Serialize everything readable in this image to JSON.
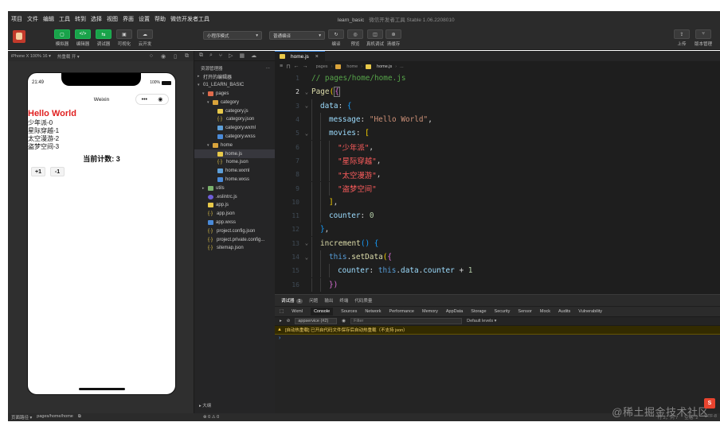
{
  "menubar": {
    "items": [
      "项目",
      "文件",
      "编辑",
      "工具",
      "转到",
      "选择",
      "视图",
      "界面",
      "设置",
      "帮助",
      "微信开发者工具"
    ],
    "project_name": "learn_basic",
    "app_title": "微信开发者工具 Stable 1.06.2208010"
  },
  "toolbar": {
    "buttons": [
      {
        "label": "模拟器",
        "icon": "phone-icon"
      },
      {
        "label": "编辑器",
        "icon": "code-icon"
      },
      {
        "label": "调试器",
        "icon": "debug-icon"
      },
      {
        "label": "可视化",
        "icon": "visual-icon"
      },
      {
        "label": "云开发",
        "icon": "cloud-icon"
      }
    ],
    "mode_select": "小程序模式",
    "compile_select": "普通编译",
    "right_buttons": [
      {
        "label": "编译",
        "icon": "refresh-icon"
      },
      {
        "label": "预览",
        "icon": "eye-icon"
      },
      {
        "label": "真机调试",
        "icon": "realdevice-icon"
      },
      {
        "label": "清缓存",
        "icon": "clear-cache-icon"
      }
    ],
    "far_right_buttons": [
      {
        "label": "上传",
        "icon": "upload-icon"
      },
      {
        "label": "版本管理",
        "icon": "version-icon"
      }
    ]
  },
  "simulator": {
    "device": "iPhone X 100% 16 ▾",
    "hot_reload": "热重载 开 ▾",
    "time": "21:49",
    "battery": "100%",
    "nav_title": "Weixin",
    "hello": "Hello World",
    "movies": [
      "少年派-0",
      "星际穿越-1",
      "太空漫游-2",
      "盗梦空间-3"
    ],
    "counter_text": "当前计数: 3",
    "btn_plus": "+1",
    "btn_minus": "-1"
  },
  "explorer": {
    "header": "资源管理器",
    "open_editors": "打开的编辑器",
    "project": "01_LEARN_BASIC",
    "outline": "大纲"
  },
  "tree": [
    {
      "label": "pages",
      "depth": 1,
      "type": "folder-pages",
      "arrow": "▾"
    },
    {
      "label": "category",
      "depth": 2,
      "type": "folder",
      "arrow": "▾"
    },
    {
      "label": "category.js",
      "depth": 3,
      "type": "js",
      "arrow": ""
    },
    {
      "label": "category.json",
      "depth": 3,
      "type": "json",
      "arrow": ""
    },
    {
      "label": "category.wxml",
      "depth": 3,
      "type": "wxml",
      "arrow": ""
    },
    {
      "label": "category.wxss",
      "depth": 3,
      "type": "wxss",
      "arrow": ""
    },
    {
      "label": "home",
      "depth": 2,
      "type": "folder",
      "arrow": "▾"
    },
    {
      "label": "home.js",
      "depth": 3,
      "type": "js",
      "arrow": "",
      "active": true
    },
    {
      "label": "home.json",
      "depth": 3,
      "type": "json",
      "arrow": ""
    },
    {
      "label": "home.wxml",
      "depth": 3,
      "type": "wxml",
      "arrow": ""
    },
    {
      "label": "home.wxss",
      "depth": 3,
      "type": "wxss",
      "arrow": ""
    },
    {
      "label": "utils",
      "depth": 1,
      "type": "folder-utils",
      "arrow": "▸"
    },
    {
      "label": ".eslintrc.js",
      "depth": 1,
      "type": "eslint",
      "arrow": ""
    },
    {
      "label": "app.js",
      "depth": 1,
      "type": "js",
      "arrow": ""
    },
    {
      "label": "app.json",
      "depth": 1,
      "type": "json",
      "arrow": ""
    },
    {
      "label": "app.wxss",
      "depth": 1,
      "type": "wxss",
      "arrow": ""
    },
    {
      "label": "project.config.json",
      "depth": 1,
      "type": "json",
      "arrow": ""
    },
    {
      "label": "project.private.config...",
      "depth": 1,
      "type": "json",
      "arrow": ""
    },
    {
      "label": "sitemap.json",
      "depth": 1,
      "type": "json",
      "arrow": ""
    }
  ],
  "editor": {
    "tab": "home.js",
    "breadcrumb": [
      "pages",
      "home",
      "home.js",
      "..."
    ],
    "current_line": 2
  },
  "code": [
    {
      "n": "1",
      "fold": "",
      "indent": 0,
      "tokens": [
        {
          "t": "// pages/home/home.js",
          "c": "tok-comment"
        }
      ]
    },
    {
      "n": "2",
      "fold": "⌄",
      "indent": 0,
      "tokens": [
        {
          "t": "Page",
          "c": "tok-func"
        },
        {
          "t": "(",
          "c": "tok-br"
        },
        {
          "t": "{",
          "c": "tok-br2 cursor-box"
        }
      ]
    },
    {
      "n": "3",
      "fold": "⌄",
      "indent": 1,
      "tokens": [
        {
          "t": "data",
          "c": "tok-key"
        },
        {
          "t": ": ",
          "c": "tok-p"
        },
        {
          "t": "{",
          "c": "tok-br3"
        }
      ]
    },
    {
      "n": "4",
      "fold": "",
      "indent": 2,
      "tokens": [
        {
          "t": "message",
          "c": "tok-key"
        },
        {
          "t": ": ",
          "c": "tok-p"
        },
        {
          "t": "\"Hello World\"",
          "c": "tok-str"
        },
        {
          "t": ",",
          "c": "tok-p"
        }
      ]
    },
    {
      "n": "5",
      "fold": "⌄",
      "indent": 2,
      "tokens": [
        {
          "t": "movies",
          "c": "tok-key"
        },
        {
          "t": ": ",
          "c": "tok-p"
        },
        {
          "t": "[",
          "c": "tok-br"
        }
      ]
    },
    {
      "n": "6",
      "fold": "",
      "indent": 3,
      "tokens": [
        {
          "t": "\"少年派\"",
          "c": "tok-strcn"
        },
        {
          "t": ",",
          "c": "tok-p"
        }
      ]
    },
    {
      "n": "7",
      "fold": "",
      "indent": 3,
      "tokens": [
        {
          "t": "\"星际穿越\"",
          "c": "tok-strcn"
        },
        {
          "t": ",",
          "c": "tok-p"
        }
      ]
    },
    {
      "n": "8",
      "fold": "",
      "indent": 3,
      "tokens": [
        {
          "t": "\"太空漫游\"",
          "c": "tok-strcn"
        },
        {
          "t": ",",
          "c": "tok-p"
        }
      ]
    },
    {
      "n": "9",
      "fold": "",
      "indent": 3,
      "tokens": [
        {
          "t": "\"盗梦空间\"",
          "c": "tok-strcn"
        }
      ]
    },
    {
      "n": "10",
      "fold": "",
      "indent": 2,
      "tokens": [
        {
          "t": "]",
          "c": "tok-br"
        },
        {
          "t": ",",
          "c": "tok-p"
        }
      ]
    },
    {
      "n": "11",
      "fold": "",
      "indent": 2,
      "tokens": [
        {
          "t": "counter",
          "c": "tok-key"
        },
        {
          "t": ": ",
          "c": "tok-p"
        },
        {
          "t": "0",
          "c": "tok-num"
        }
      ]
    },
    {
      "n": "12",
      "fold": "",
      "indent": 1,
      "tokens": [
        {
          "t": "}",
          "c": "tok-br3"
        },
        {
          "t": ",",
          "c": "tok-p"
        }
      ]
    },
    {
      "n": "13",
      "fold": "⌄",
      "indent": 1,
      "tokens": [
        {
          "t": "increment",
          "c": "tok-fn2"
        },
        {
          "t": "() ",
          "c": "tok-br3"
        },
        {
          "t": "{",
          "c": "tok-br3"
        }
      ]
    },
    {
      "n": "14",
      "fold": "⌄",
      "indent": 2,
      "tokens": [
        {
          "t": "this",
          "c": "tok-this"
        },
        {
          "t": ".",
          "c": "tok-p"
        },
        {
          "t": "setData",
          "c": "tok-fn2"
        },
        {
          "t": "(",
          "c": "tok-br"
        },
        {
          "t": "{",
          "c": "tok-br2"
        }
      ]
    },
    {
      "n": "15",
      "fold": "",
      "indent": 3,
      "tokens": [
        {
          "t": "counter",
          "c": "tok-key"
        },
        {
          "t": ": ",
          "c": "tok-p"
        },
        {
          "t": "this",
          "c": "tok-this"
        },
        {
          "t": ".",
          "c": "tok-p"
        },
        {
          "t": "data",
          "c": "tok-key"
        },
        {
          "t": ".",
          "c": "tok-p"
        },
        {
          "t": "counter",
          "c": "tok-key"
        },
        {
          "t": " + ",
          "c": "tok-p"
        },
        {
          "t": "1",
          "c": "tok-num"
        }
      ]
    },
    {
      "n": "16",
      "fold": "",
      "indent": 2,
      "tokens": [
        {
          "t": "})",
          "c": "tok-br2"
        }
      ]
    }
  ],
  "debugger": {
    "top_tabs": [
      "调试器",
      "问题",
      "输出",
      "终端",
      "代码质量"
    ],
    "top_badge": "1",
    "tabs": [
      "Wxml",
      "Console",
      "Sources",
      "Network",
      "Performance",
      "Memory",
      "AppData",
      "Storage",
      "Security",
      "Sensor",
      "Mock",
      "Audits",
      "Vulnerability"
    ],
    "active_tab": "Console",
    "context": "appservice (#2)",
    "filter_placeholder": "Filter",
    "levels": "Default levels ▾",
    "warning": "[自动热重载] 已开启代码文件保存后自动热重载（不支持 json）",
    "prompt": "›"
  },
  "statusbar": {
    "path_label": "页面路径 ▾",
    "path": "pages/home/home",
    "errors": "⊗ 0 ⚠ 0",
    "right": [
      "行 2，列 7",
      "空格: 2",
      "UTF-8"
    ]
  },
  "watermark": "@稀土掘金技术社区",
  "watermark_badge": "S"
}
